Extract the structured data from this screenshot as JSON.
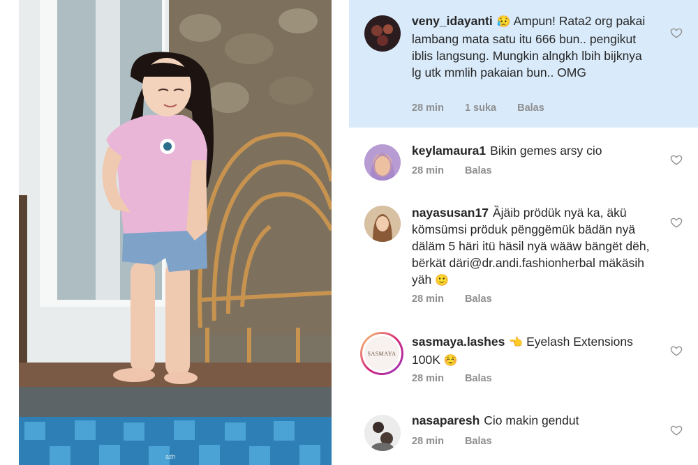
{
  "photo": {
    "watermark": "azh"
  },
  "comments": [
    {
      "username": "veny_idayanti",
      "emoji_after_name": "😥",
      "text": "Ampun! Rata2 org pakai lambang mata satu itu 666 bun.. pengikut iblis langsung. Mungkin alngkh lbih bijknya lg utk mmlih pakaian bun.. OMG",
      "time": "28 min",
      "likes": "1 suka",
      "reply": "Balas",
      "highlighted": true
    },
    {
      "username": "keylamaura1",
      "text": "Bikin gemes arsy cio",
      "time": "28 min",
      "reply": "Balas"
    },
    {
      "username": "nayasusan17",
      "text": "Ȁjäib prödük nyä ka, äkü kömsümsi pröduk  pënggëmük bädän nyä däläm 5 häri itü häsil nyä wääw bängët dëh, bërkät däri@dr.andi.fashionherbal mäkäsih yäh",
      "emoji_after_text": "🙂",
      "time": "28 min",
      "reply": "Balas"
    },
    {
      "username": "sasmaya.lashes",
      "emoji_after_name": "👈",
      "text": "Eyelash Extensions 100K",
      "emoji_after_text": "☺️",
      "avatar_text": "SASMAYA",
      "time": "28 min",
      "reply": "Balas"
    },
    {
      "username": "nasaparesh",
      "text": "Cio makin gendut",
      "time": "28 min",
      "reply": "Balas"
    }
  ],
  "icons": {
    "like": "heart-outline-icon"
  },
  "colors": {
    "highlight_bg": "#d9ebfb",
    "meta_text": "#8e8e8e",
    "text": "#262626",
    "sasmaya_ring": "#c13584"
  }
}
